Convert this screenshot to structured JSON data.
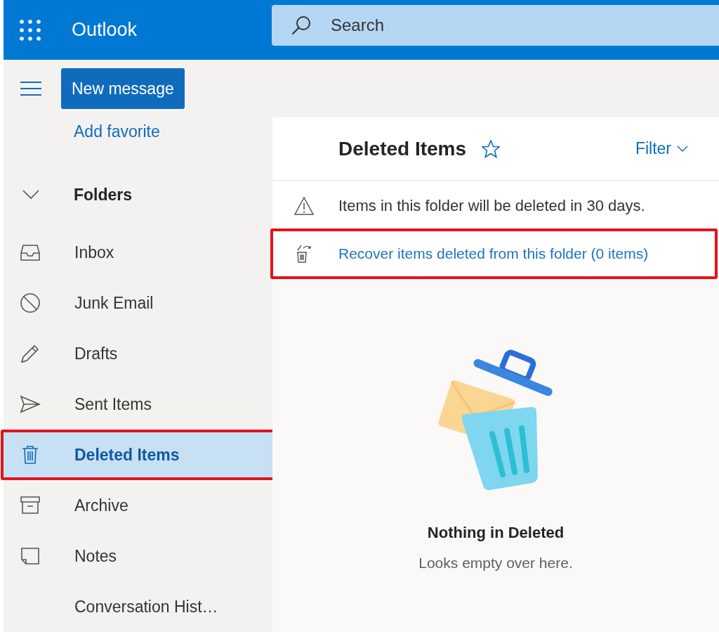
{
  "header": {
    "app_name": "Outlook",
    "search": {
      "placeholder": "Search"
    }
  },
  "toolbar": {
    "new_message": "New message"
  },
  "sidebar": {
    "add_favorite": "Add favorite",
    "folders_label": "Folders",
    "folders_expanded": true,
    "items": [
      {
        "kind": "inbox",
        "label": "Inbox",
        "selected": false,
        "highlighted": false
      },
      {
        "kind": "junk",
        "label": "Junk Email",
        "selected": false,
        "highlighted": false
      },
      {
        "kind": "drafts",
        "label": "Drafts",
        "selected": false,
        "highlighted": false
      },
      {
        "kind": "sent",
        "label": "Sent Items",
        "selected": false,
        "highlighted": false
      },
      {
        "kind": "deleted",
        "label": "Deleted Items",
        "selected": true,
        "highlighted": true
      },
      {
        "kind": "archive",
        "label": "Archive",
        "selected": false,
        "highlighted": false
      },
      {
        "kind": "notes",
        "label": "Notes",
        "selected": false,
        "highlighted": false
      },
      {
        "kind": "plain",
        "label": "Conversation Hist…",
        "selected": false,
        "highlighted": false
      }
    ]
  },
  "main": {
    "title": "Deleted Items",
    "favorite": false,
    "filter": "Filter",
    "notices": [
      {
        "kind": "warning",
        "text": "Items in this folder will be deleted in 30 days.",
        "link": false,
        "highlighted": false
      },
      {
        "kind": "recover",
        "text": "Recover items deleted from this folder (0 items)",
        "link": true,
        "highlighted": true
      }
    ],
    "empty_state": {
      "title": "Nothing in Deleted",
      "subtitle": "Looks empty over here."
    }
  }
}
